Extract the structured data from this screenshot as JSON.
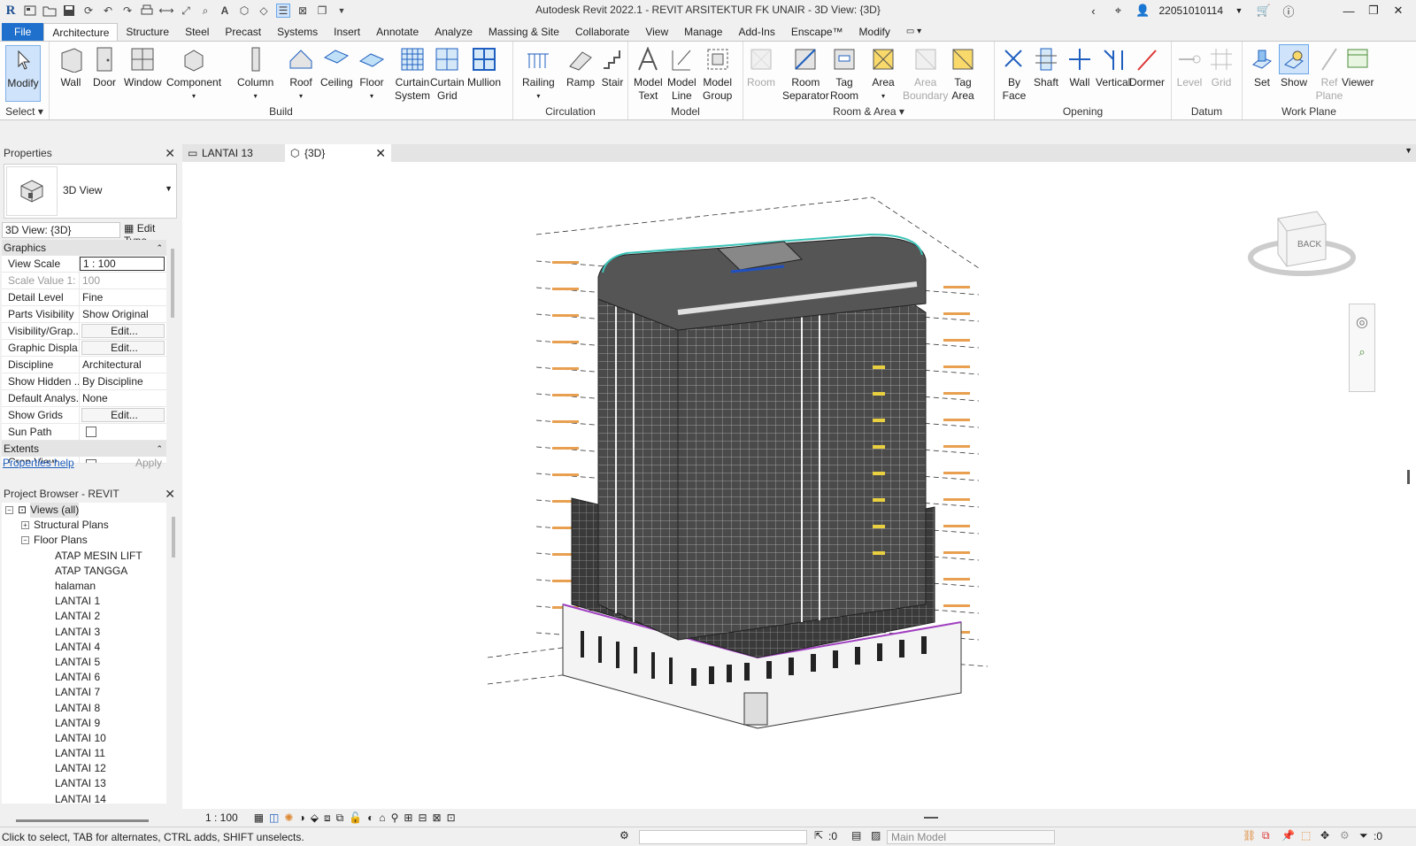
{
  "title": "Autodesk Revit 2022.1 - REVIT ARSITEKTUR FK UNAIR - 3D View: {3D}",
  "user": "22051010114",
  "tabs": [
    "File",
    "Architecture",
    "Structure",
    "Steel",
    "Precast",
    "Systems",
    "Insert",
    "Annotate",
    "Analyze",
    "Massing & Site",
    "Collaborate",
    "View",
    "Manage",
    "Add-Ins",
    "Enscape™",
    "Modify"
  ],
  "ribbon": {
    "panels": {
      "select": "Select",
      "build": "Build",
      "circulation": "Circulation",
      "model": "Model",
      "room_area": "Room & Area",
      "opening": "Opening",
      "datum": "Datum",
      "work_plane": "Work Plane"
    },
    "tools": {
      "modify": "Modify",
      "wall": "Wall",
      "door": "Door",
      "window": "Window",
      "component": "Component",
      "column": "Column",
      "roof": "Roof",
      "ceiling": "Ceiling",
      "floor": "Floor",
      "curtain_system_1": "Curtain",
      "curtain_system_2": "System",
      "curtain_grid_1": "Curtain",
      "curtain_grid_2": "Grid",
      "mullion": "Mullion",
      "railing": "Railing",
      "ramp": "Ramp",
      "stair": "Stair",
      "model_text_1": "Model",
      "model_text_2": "Text",
      "model_line_1": "Model",
      "model_line_2": "Line",
      "model_group_1": "Model",
      "model_group_2": "Group",
      "room": "Room",
      "room_sep_1": "Room",
      "room_sep_2": "Separator",
      "tag_room_1": "Tag",
      "tag_room_2": "Room",
      "area": "Area",
      "area_boundary_1": "Area",
      "area_boundary_2": "Boundary",
      "tag_area_1": "Tag",
      "tag_area_2": "Area",
      "by_face_1": "By",
      "by_face_2": "Face",
      "shaft": "Shaft",
      "wall_open": "Wall",
      "vertical": "Vertical",
      "dormer": "Dormer",
      "level": "Level",
      "grid": "Grid",
      "set": "Set",
      "show": "Show",
      "ref_plane_1": "Ref",
      "ref_plane_2": "Plane",
      "viewer": "Viewer"
    }
  },
  "properties": {
    "title": "Properties",
    "type_name": "3D View",
    "selector": "3D View: {3D}",
    "edit_type": "Edit Type",
    "groups": {
      "graphics": "Graphics",
      "extents": "Extents"
    },
    "rows": [
      {
        "k": "View Scale",
        "v": "1 : 100"
      },
      {
        "k": "Scale Value    1:",
        "v": "100"
      },
      {
        "k": "Detail Level",
        "v": "Fine"
      },
      {
        "k": "Parts Visibility",
        "v": "Show Original"
      },
      {
        "k": "Visibility/Grap...",
        "v": "Edit..."
      },
      {
        "k": "Graphic Displa...",
        "v": "Edit..."
      },
      {
        "k": "Discipline",
        "v": "Architectural"
      },
      {
        "k": "Show Hidden ...",
        "v": "By Discipline"
      },
      {
        "k": "Default Analys...",
        "v": "None"
      },
      {
        "k": "Show Grids",
        "v": "Edit..."
      },
      {
        "k": "Sun Path",
        "v": ""
      }
    ],
    "crop_view": "Crop View",
    "help": "Properties help",
    "apply": "Apply"
  },
  "browser": {
    "title": "Project Browser - REVIT ARSITEKTU...",
    "root": "Views (all)",
    "structural": "Structural Plans",
    "floor_plans": "Floor Plans",
    "items": [
      "ATAP MESIN LIFT",
      "ATAP TANGGA",
      "halaman",
      "LANTAI 1",
      "LANTAI 2",
      "LANTAI 3",
      "LANTAI 4",
      "LANTAI 5",
      "LANTAI 6",
      "LANTAI 7",
      "LANTAI 8",
      "LANTAI 9",
      "LANTAI 10",
      "LANTAI 11",
      "LANTAI 12",
      "LANTAI 13",
      "LANTAI 14"
    ]
  },
  "view_tabs": [
    {
      "label": "LANTAI 13"
    },
    {
      "label": "{3D}"
    }
  ],
  "viewcube": {
    "face": "BACK"
  },
  "view_scale": "1 : 100",
  "status": {
    "message": "Click to select, TAB for alternates, CTRL adds, SHIFT unselects.",
    "zero1": ":0",
    "main_model": "Main Model",
    "filter_count": ":0"
  },
  "colors": {
    "file_tab": "#1f6fcc",
    "selection": "#cfe3fa"
  }
}
